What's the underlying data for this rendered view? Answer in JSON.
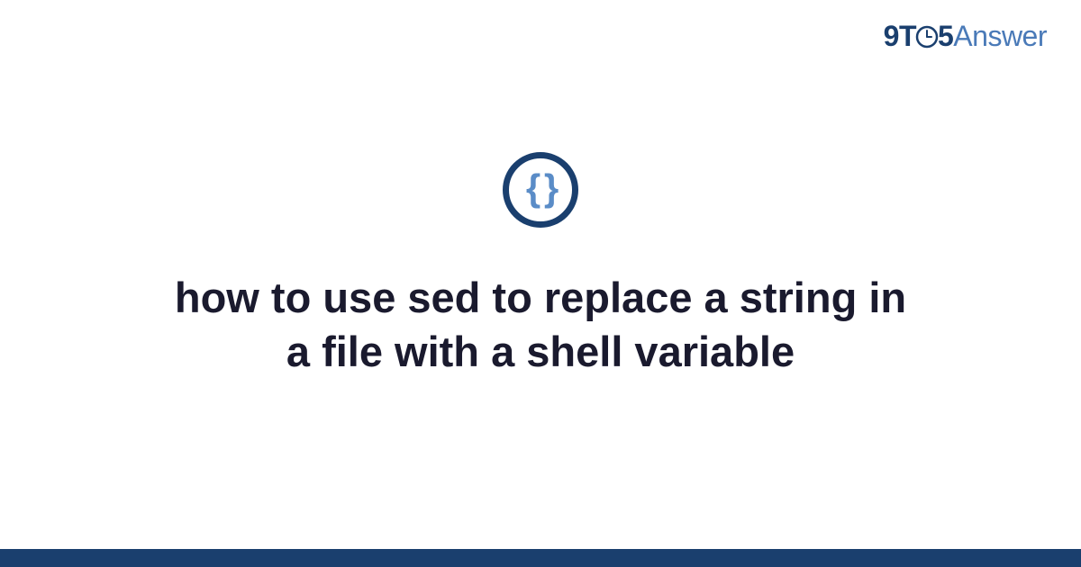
{
  "brand": {
    "part1": "9T",
    "part2": "5",
    "part3": "Answer"
  },
  "category_icon": {
    "name": "code-braces-icon",
    "glyph": "{ }"
  },
  "title": "how to use sed to replace a string in a file with a shell variable",
  "colors": {
    "primary": "#1a3f6e",
    "accent": "#5a8cc7",
    "text": "#1a1a2e"
  }
}
